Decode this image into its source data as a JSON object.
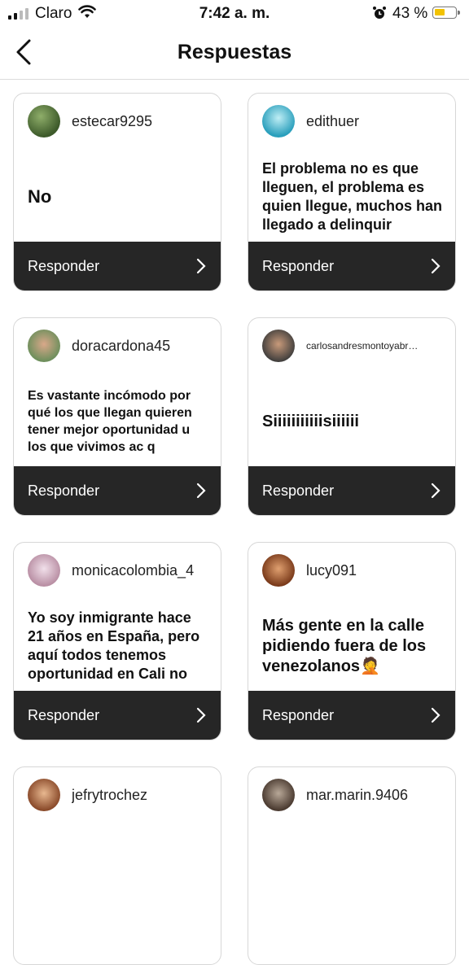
{
  "status_bar": {
    "carrier": "Claro",
    "time": "7:42 a. m.",
    "battery_percent": "43 %",
    "battery_color": "#f2c200",
    "icons": [
      "signal-icon",
      "wifi-icon",
      "alarm-icon",
      "battery-icon"
    ]
  },
  "header": {
    "title": "Respuestas",
    "back_icon": "chevron-left-icon"
  },
  "cards": [
    {
      "username": "estecar9295",
      "text": "No",
      "reply_label": "Responder",
      "avatar_color": "#4d6b3a"
    },
    {
      "username": "edithuer",
      "text": "El problema no es que lleguen, el problema es quien llegue, muchos han llegado a delinquir",
      "reply_label": "Responder",
      "avatar_color": "#3ab0c8"
    },
    {
      "username": "doracardona45",
      "text": "Es vastante incómodo por qué los que llegan quieren tener mejor oportunidad u los que vivimos ac q",
      "reply_label": "Responder",
      "avatar_color": "#7a9a6a"
    },
    {
      "username": "carlosandresmontoyabr…",
      "text": "Siiiiiiiiiiisiiiiii",
      "reply_label": "Responder",
      "avatar_color": "#8a6a55"
    },
    {
      "username": "monicacolombia_4",
      "text": "Yo soy inmigrante hace 21 años en España, pero aquí todos tenemos oportunidad en Cali no",
      "reply_label": "Responder",
      "avatar_color": "#c9a8b8"
    },
    {
      "username": "lucy091",
      "text": "Más gente en la calle pidiendo fuera de los venezolanos🤦",
      "reply_label": "Responder",
      "avatar_color": "#a0522d"
    },
    {
      "username": "jefrytrochez",
      "text": "",
      "reply_label": "",
      "avatar_color": "#b07a4a"
    },
    {
      "username": "mar.marin.9406",
      "text": "",
      "reply_label": "",
      "avatar_color": "#5a4a40"
    }
  ]
}
